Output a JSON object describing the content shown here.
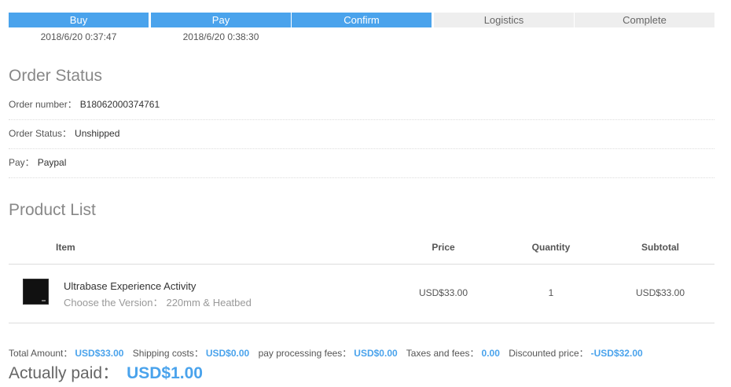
{
  "progress": {
    "steps": [
      {
        "label": "Buy",
        "status": "done",
        "time": "2018/6/20 0:37:47"
      },
      {
        "label": "Pay",
        "status": "done",
        "time": "2018/6/20 0:38:30"
      },
      {
        "label": "Confirm",
        "status": "done",
        "time": ""
      },
      {
        "label": "Logistics",
        "status": "pending",
        "time": ""
      },
      {
        "label": "Complete",
        "status": "pending",
        "time": ""
      }
    ],
    "active_color": "#4aa3ec",
    "pending_color": "#eeeeee"
  },
  "order_status": {
    "title": "Order Status",
    "order_number_label": "Order number：",
    "order_number": "B18062000374761",
    "status_label": "Order Status：",
    "status": "Unshipped",
    "pay_label": "Pay：",
    "pay": "Paypal"
  },
  "product_list": {
    "title": "Product List",
    "columns": {
      "item": "Item",
      "price": "Price",
      "quantity": "Quantity",
      "subtotal": "Subtotal"
    },
    "items": [
      {
        "name": "Ultrabase Experience Activity",
        "variant_label": "Choose the Version：",
        "variant": "220mm & Heatbed",
        "price": "USD$33.00",
        "quantity": "1",
        "subtotal": "USD$33.00"
      }
    ]
  },
  "totals": {
    "total_amount_label": "Total Amount：",
    "total_amount": "USD$33.00",
    "shipping_label": "Shipping costs：",
    "shipping": "USD$0.00",
    "processing_label": "pay processing fees：",
    "processing": "USD$0.00",
    "taxes_label": "Taxes and fees：",
    "taxes": "0.00",
    "discount_label": "Discounted price：",
    "discount": "-USD$32.00",
    "paid_label": "Actually paid：",
    "paid": "USD$1.00"
  }
}
